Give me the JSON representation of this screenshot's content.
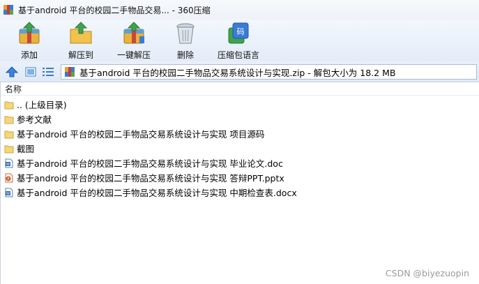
{
  "window": {
    "title": "基于android 平台的校园二手物品交易... - 360压缩"
  },
  "toolbar": {
    "add_label": "添加",
    "extract_to_label": "解压到",
    "one_click_extract_label": "一键解压",
    "delete_label": "删除",
    "language_label": "压缩包语言"
  },
  "address": {
    "path": "基于android 平台的校园二手物品交易系统设计与实现.zip - 解包大小为 18.2 MB"
  },
  "list": {
    "column_name": "名称",
    "items": [
      {
        "name": ".. (上级目录)",
        "type": "folder"
      },
      {
        "name": "参考文献",
        "type": "folder"
      },
      {
        "name": "基于android 平台的校园二手物品交易系统设计与实现 项目源码",
        "type": "folder"
      },
      {
        "name": "截图",
        "type": "folder"
      },
      {
        "name": "基于android 平台的校园二手物品交易系统设计与实现 毕业论文.doc",
        "type": "word"
      },
      {
        "name": "基于android 平台的校园二手物品交易系统设计与实现 答辩PPT.pptx",
        "type": "ppt"
      },
      {
        "name": "基于android 平台的校园二手物品交易系统设计与实现 中期检查表.docx",
        "type": "word"
      }
    ]
  },
  "watermark": "CSDN @biyezuopin",
  "colors": {
    "folder": "#f5d77a",
    "toolbar_bg": "#e3ecf8",
    "word": "#2f63b3",
    "ppt": "#d35b2a"
  }
}
